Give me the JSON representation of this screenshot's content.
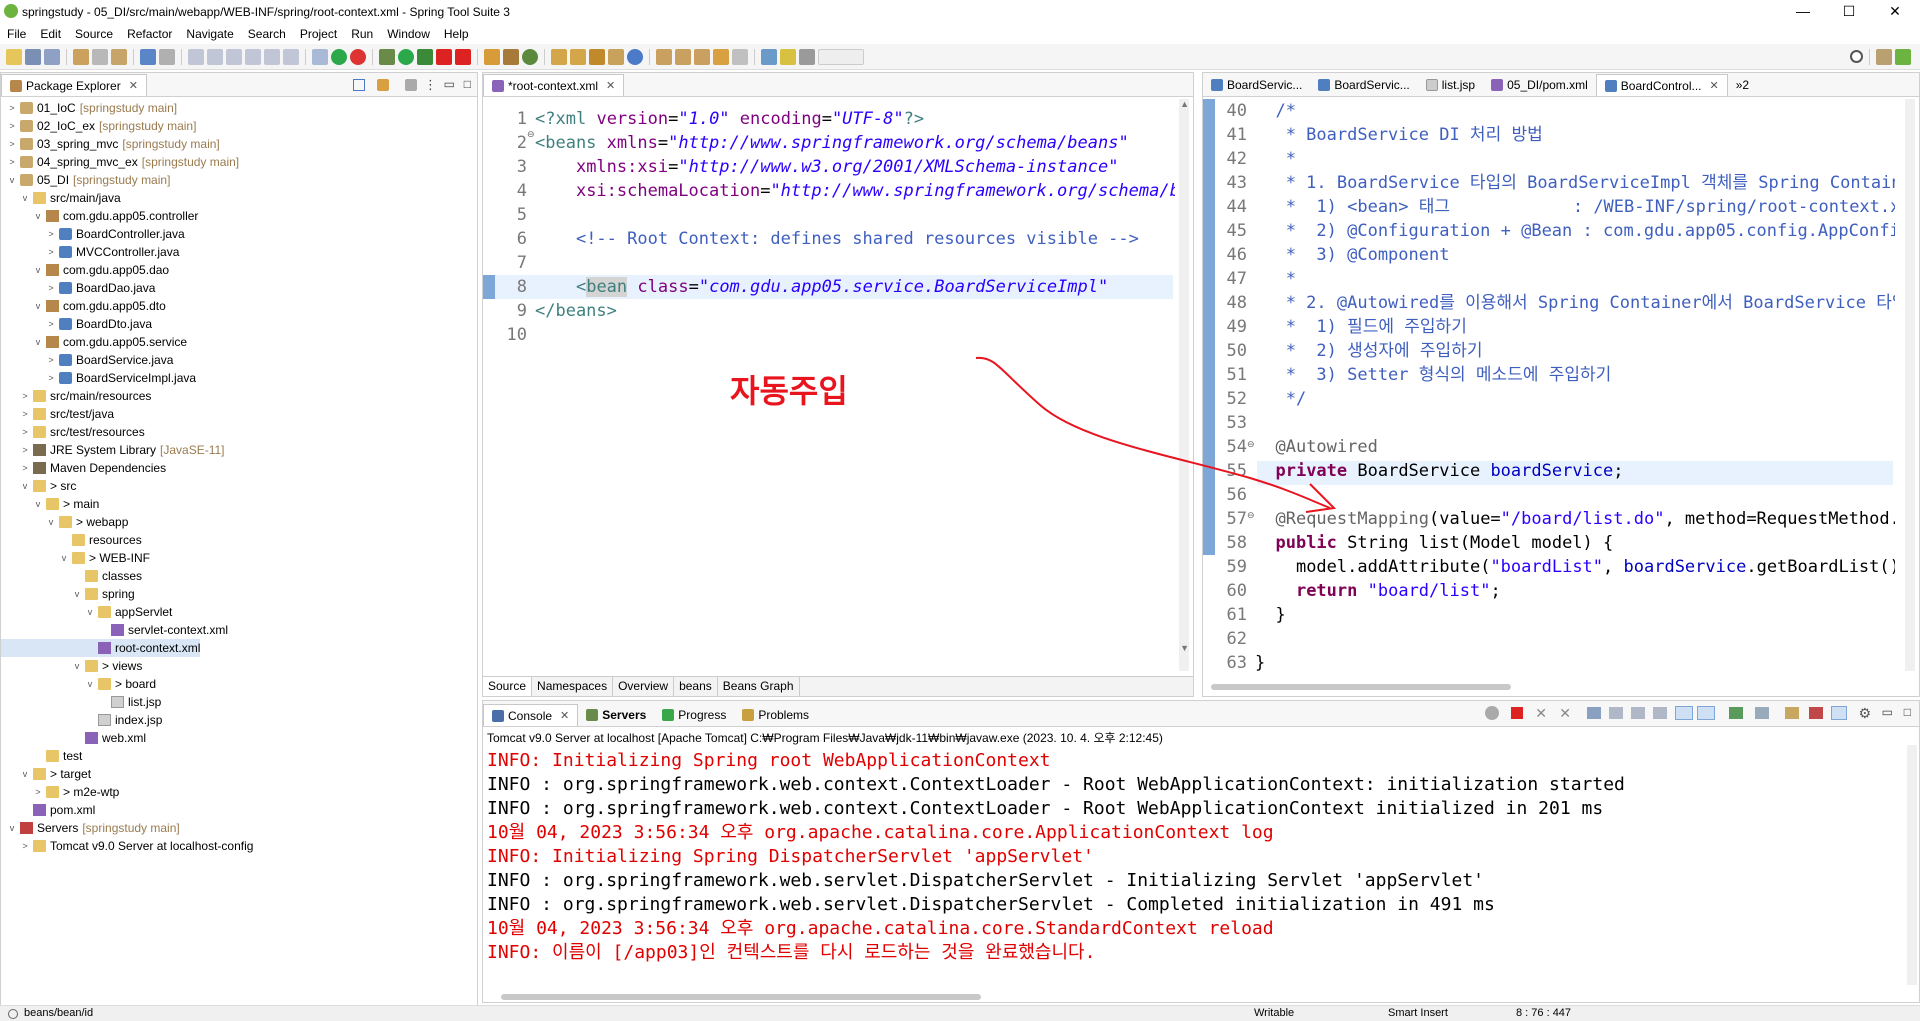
{
  "window": {
    "title": "springstudy - 05_DI/src/main/webapp/WEB-INF/spring/root-context.xml - Spring Tool Suite 3",
    "minimize": "—",
    "maximize": "☐",
    "close": "✕"
  },
  "menu": [
    "File",
    "Edit",
    "Source",
    "Refactor",
    "Navigate",
    "Search",
    "Project",
    "Run",
    "Window",
    "Help"
  ],
  "package_explorer": {
    "title": "Package Explorer",
    "tree": [
      {
        "depth": 0,
        "twisty": ">",
        "icon": "proj",
        "label": "01_IoC",
        "note": "[springstudy main]"
      },
      {
        "depth": 0,
        "twisty": ">",
        "icon": "proj",
        "label": "02_IoC_ex",
        "note": "[springstudy main]"
      },
      {
        "depth": 0,
        "twisty": ">",
        "icon": "proj",
        "label": "03_spring_mvc",
        "note": "[springstudy main]"
      },
      {
        "depth": 0,
        "twisty": ">",
        "icon": "proj",
        "label": "04_spring_mvc_ex",
        "note": "[springstudy main]"
      },
      {
        "depth": 0,
        "twisty": "v",
        "icon": "proj",
        "label": "05_DI",
        "note": "[springstudy main]"
      },
      {
        "depth": 1,
        "twisty": "v",
        "icon": "folder",
        "label": "src/main/java",
        "note": ""
      },
      {
        "depth": 2,
        "twisty": "v",
        "icon": "pkg",
        "label": "com.gdu.app05.controller",
        "note": ""
      },
      {
        "depth": 3,
        "twisty": ">",
        "icon": "java",
        "label": "BoardController.java",
        "note": ""
      },
      {
        "depth": 3,
        "twisty": ">",
        "icon": "java",
        "label": "MVCController.java",
        "note": ""
      },
      {
        "depth": 2,
        "twisty": "v",
        "icon": "pkg",
        "label": "com.gdu.app05.dao",
        "note": ""
      },
      {
        "depth": 3,
        "twisty": ">",
        "icon": "java",
        "label": "BoardDao.java",
        "note": ""
      },
      {
        "depth": 2,
        "twisty": "v",
        "icon": "pkg",
        "label": "com.gdu.app05.dto",
        "note": ""
      },
      {
        "depth": 3,
        "twisty": ">",
        "icon": "java",
        "label": "BoardDto.java",
        "note": ""
      },
      {
        "depth": 2,
        "twisty": "v",
        "icon": "pkg",
        "label": "com.gdu.app05.service",
        "note": ""
      },
      {
        "depth": 3,
        "twisty": ">",
        "icon": "java",
        "label": "BoardService.java",
        "note": ""
      },
      {
        "depth": 3,
        "twisty": ">",
        "icon": "java",
        "label": "BoardServiceImpl.java",
        "note": ""
      },
      {
        "depth": 1,
        "twisty": ">",
        "icon": "folder",
        "label": "src/main/resources",
        "note": ""
      },
      {
        "depth": 1,
        "twisty": ">",
        "icon": "folder",
        "label": "src/test/java",
        "note": ""
      },
      {
        "depth": 1,
        "twisty": ">",
        "icon": "folder",
        "label": "src/test/resources",
        "note": ""
      },
      {
        "depth": 1,
        "twisty": ">",
        "icon": "lib",
        "label": "JRE System Library",
        "note": "[JavaSE-11]"
      },
      {
        "depth": 1,
        "twisty": ">",
        "icon": "lib",
        "label": "Maven Dependencies",
        "note": ""
      },
      {
        "depth": 1,
        "twisty": "v",
        "icon": "folder",
        "label": "> src",
        "note": ""
      },
      {
        "depth": 2,
        "twisty": "v",
        "icon": "folder",
        "label": "> main",
        "note": ""
      },
      {
        "depth": 3,
        "twisty": "v",
        "icon": "folder",
        "label": "> webapp",
        "note": ""
      },
      {
        "depth": 4,
        "twisty": "",
        "icon": "folder",
        "label": "resources",
        "note": ""
      },
      {
        "depth": 4,
        "twisty": "v",
        "icon": "folder",
        "label": "> WEB-INF",
        "note": ""
      },
      {
        "depth": 5,
        "twisty": "",
        "icon": "folder",
        "label": "classes",
        "note": ""
      },
      {
        "depth": 5,
        "twisty": "v",
        "icon": "folder",
        "label": "spring",
        "note": ""
      },
      {
        "depth": 6,
        "twisty": "v",
        "icon": "folder",
        "label": "appServlet",
        "note": ""
      },
      {
        "depth": 7,
        "twisty": "",
        "icon": "xml",
        "label": "servlet-context.xml",
        "note": ""
      },
      {
        "depth": 6,
        "twisty": "",
        "icon": "xml",
        "label": "root-context.xml",
        "note": "",
        "selected": true
      },
      {
        "depth": 5,
        "twisty": "v",
        "icon": "folder",
        "label": "> views",
        "note": ""
      },
      {
        "depth": 6,
        "twisty": "v",
        "icon": "folder",
        "label": "> board",
        "note": ""
      },
      {
        "depth": 7,
        "twisty": "",
        "icon": "jsp",
        "label": "list.jsp",
        "note": ""
      },
      {
        "depth": 6,
        "twisty": "",
        "icon": "jsp",
        "label": "index.jsp",
        "note": ""
      },
      {
        "depth": 5,
        "twisty": "",
        "icon": "xml",
        "label": "web.xml",
        "note": ""
      },
      {
        "depth": 2,
        "twisty": "",
        "icon": "folder",
        "label": "test",
        "note": ""
      },
      {
        "depth": 1,
        "twisty": "v",
        "icon": "folder",
        "label": "> target",
        "note": ""
      },
      {
        "depth": 2,
        "twisty": ">",
        "icon": "folder",
        "label": "> m2e-wtp",
        "note": ""
      },
      {
        "depth": 1,
        "twisty": "",
        "icon": "xml",
        "label": "pom.xml",
        "note": ""
      },
      {
        "depth": 0,
        "twisty": "v",
        "icon": "server",
        "label": "Servers",
        "note": "[springstudy main]"
      },
      {
        "depth": 1,
        "twisty": ">",
        "icon": "folder",
        "label": "Tomcat v9.0 Server at localhost-config",
        "note": ""
      }
    ]
  },
  "editor_left": {
    "tab": "*root-context.xml",
    "bottom_tabs": [
      "Source",
      "Namespaces",
      "Overview",
      "beans",
      "Beans Graph"
    ],
    "line_numbers": [
      "1",
      "2",
      "3",
      "4",
      "5",
      "6",
      "7",
      "8",
      "9",
      "10"
    ]
  },
  "editor_right": {
    "tabs": [
      "BoardServic...",
      "BoardServic...",
      "list.jsp",
      "05_DI/pom.xml",
      "BoardControl...",
      "»2"
    ],
    "line_numbers": [
      "40",
      "41",
      "42",
      "43",
      "44",
      "45",
      "46",
      "47",
      "48",
      "49",
      "50",
      "51",
      "52",
      "53",
      "54",
      "55",
      "56",
      "57",
      "58",
      "59",
      "60",
      "61",
      "62",
      "63"
    ]
  },
  "annotation": {
    "text": "자동주입",
    "color": "#e8141e"
  },
  "console": {
    "tabs": [
      "Console",
      "Servers",
      "Progress",
      "Problems"
    ],
    "header": "Tomcat v9.0 Server at localhost [Apache Tomcat] C:₩Program Files₩Java₩jdk-11₩bin₩javaw.exe  (2023. 10. 4. 오후 2:12:45)",
    "lines": [
      {
        "text": "INFO: Initializing Spring root WebApplicationContext",
        "color": "red"
      },
      {
        "text": "INFO : org.springframework.web.context.ContextLoader - Root WebApplicationContext: initialization started",
        "color": "black"
      },
      {
        "text": "INFO : org.springframework.web.context.ContextLoader - Root WebApplicationContext initialized in 201 ms",
        "color": "black"
      },
      {
        "text": "10월 04, 2023 3:56:34 오후 org.apache.catalina.core.ApplicationContext log",
        "color": "red"
      },
      {
        "text": "INFO: Initializing Spring DispatcherServlet 'appServlet'",
        "color": "red"
      },
      {
        "text": "INFO : org.springframework.web.servlet.DispatcherServlet - Initializing Servlet 'appServlet'",
        "color": "black"
      },
      {
        "text": "INFO : org.springframework.web.servlet.DispatcherServlet - Completed initialization in 491 ms",
        "color": "black"
      },
      {
        "text": "10월 04, 2023 3:56:34 오후 org.apache.catalina.core.StandardContext reload",
        "color": "red"
      },
      {
        "text": "INFO: 이름이 [/app03]인 컨텍스트를 다시 로드하는 것을 완료했습니다.",
        "color": "red"
      }
    ]
  },
  "statusbar": {
    "left": "beans/bean/id",
    "writable": "Writable",
    "insert": "Smart Insert",
    "position": "8 : 76 : 447"
  }
}
